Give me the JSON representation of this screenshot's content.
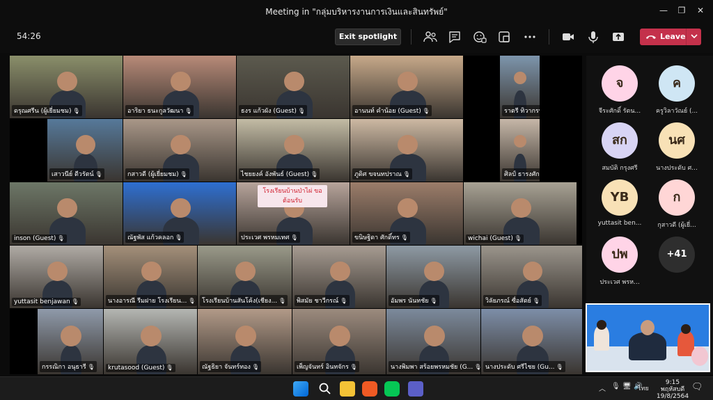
{
  "window": {
    "title": "Meeting in \"กลุ่มบริหารงานการเงินและสินทรัพย์\""
  },
  "toolbar": {
    "timer": "54:26",
    "exit_spotlight_label": "Exit spotlight",
    "leave_label": "Leave",
    "icons": [
      "people-icon",
      "chat-icon",
      "reactions-icon",
      "share-tray-icon",
      "more-icon",
      "camera-icon",
      "mic-icon",
      "share-icon"
    ]
  },
  "grid": {
    "tiles": [
      {
        "name": "ดรุณศรีน (ผู้เยี่ยมชม)",
        "bg": "#8a8f6a"
      },
      {
        "name": "อาริยา ธนะกูลวัฒนา",
        "bg": "#b88a78"
      },
      {
        "name": "ธงร แก้วผัง (Guest)",
        "bg": "#5c5a4e"
      },
      {
        "name": "อานนท์ คำน้อย (Guest)",
        "bg": "#c7a98a"
      },
      {
        "name": "ราตรี ทิวากรพรรณราย",
        "bg": "#7d95ac"
      },
      {
        "name": "เสาวนีย์ ดีวรัตน์",
        "bg": "#56799a"
      },
      {
        "name": "กสาวดี (ผู้เยี่ยมชม)",
        "bg": "#a99788"
      },
      {
        "name": "ไชยยงค์ อังพันธ์ (Guest)",
        "bg": "#c3bca5"
      },
      {
        "name": "ภูดิศ ขจนทปราณ",
        "bg": "#cdb9a3"
      },
      {
        "name": "ศิลป์ ธารงศักดิ์มาก",
        "bg": "#c6b7a8"
      },
      {
        "name": "inson (Guest)",
        "bg": "#6d7767"
      },
      {
        "name": "ณัฐพัส แก้วคลอก",
        "bg": "#2e6fd1"
      },
      {
        "name": "ประเวศ พรหมเทศ",
        "bg": "#b7a49b"
      },
      {
        "name": "ขนิษฐิดา ศักดิ์ทร",
        "bg": "#9c7d6a"
      },
      {
        "name": "wichai (Guest)",
        "bg": "#a8a294"
      },
      {
        "name": "yuttasit benjawan",
        "bg": "#b0aba5"
      },
      {
        "name": "นางอารณี รีมฝาย โรงเรียน...",
        "bg": "#a4907a"
      },
      {
        "name": "โรงเรียนบ้านสันโค้ง(เชียง...",
        "bg": "#9a9a8a"
      },
      {
        "name": "พิสมัย ชาวีกรณ์",
        "bg": "#a79c92"
      },
      {
        "name": "อัมพร นันทชัย",
        "bg": "#8e9aa4"
      },
      {
        "name": "วิลัยภรณ์ ซื่อสัตย์",
        "bg": "#9b958c"
      },
      {
        "name": "กรรณิกา อนุธารี",
        "bg": "#8f9aaa"
      },
      {
        "name": "krutasood (Guest)",
        "bg": "#b4b6b2"
      },
      {
        "name": "ณัฐธิยา จันทร์ทอง",
        "bg": "#b29a88"
      },
      {
        "name": "เพ็ญจันทร์ อินทจักร",
        "bg": "#9c8b7e"
      },
      {
        "name": "นางพิมพา สร้อยพรหมชัย (G...",
        "bg": "#7c8a9c"
      },
      {
        "name": "นางประดับ ศรีไชย (Gu...",
        "bg": "#7d8ea8"
      }
    ],
    "sign_text": "โรงเรียนบ้านป่าไผ่ ขอต้อนรับ"
  },
  "attendees": [
    {
      "initials": "จ",
      "name": "จีระศักดิ์ รัตน...",
      "color": "#ffd4e7"
    },
    {
      "initials": "ค",
      "name": "ครูวิลาวัณย์ (...",
      "color": "#cfe6f4"
    },
    {
      "initials": "สก",
      "name": "สมบัติ กรุงศรี",
      "color": "#d8d4f4"
    },
    {
      "initials": "นศ",
      "name": "นางประดับ ศ...",
      "color": "#f8e1b6"
    },
    {
      "initials": "YB",
      "name": "yuttasit ben...",
      "color": "#f8e1b6"
    },
    {
      "initials": "ก",
      "name": "กุสาวดี (ผู้เยี่...",
      "color": "#ffd6d6"
    },
    {
      "initials": "ปพ",
      "name": "ประเวศ พรห...",
      "color": "#ffd4e7"
    }
  ],
  "more_count": "+41",
  "taskbar": {
    "lang": "ไทย",
    "time": "9:15",
    "day": "พฤหัสบดี",
    "date": "19/8/2564"
  }
}
